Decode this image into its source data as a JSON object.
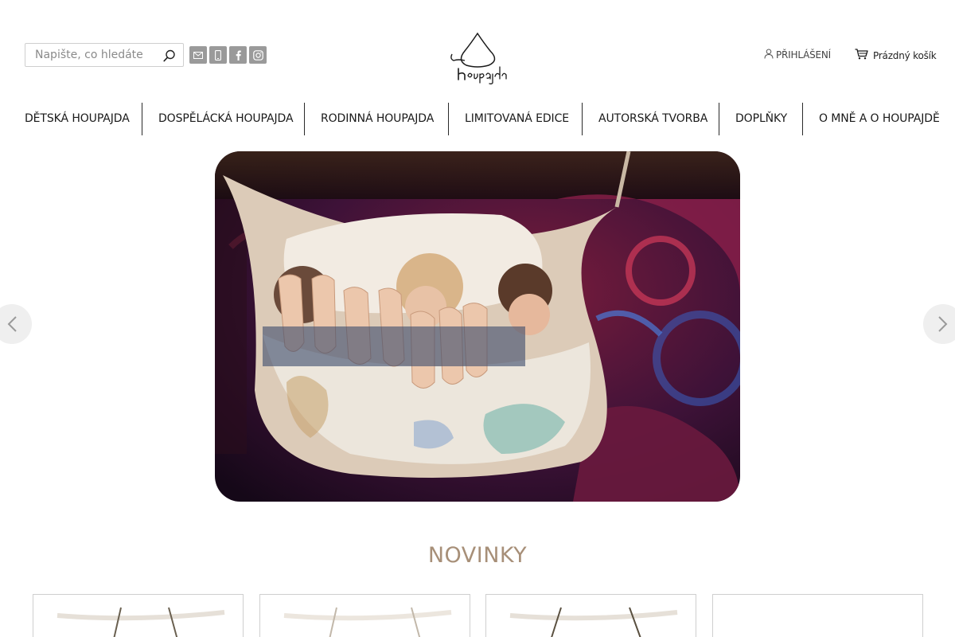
{
  "header": {
    "search": {
      "placeholder": "Napište, co hledáte"
    },
    "social_icons": [
      "email-icon",
      "phone-icon",
      "facebook-icon",
      "instagram-icon"
    ],
    "logo_text": "Houpajda",
    "login_label": "PŘIHLÁŠENÍ",
    "cart_label": "Prázdný košík"
  },
  "nav": {
    "items": [
      "DĚTSKÁ HOUPAJDA",
      "DOSPĚLÁCKÁ HOUPAJDA",
      "RODINNÁ HOUPAJDA",
      "LIMITOVANÁ EDICE",
      "AUTORSKÁ TVORBA",
      "DOPLŇKY",
      "O MNĚ A O HOUPAJDĚ"
    ]
  },
  "hero": {
    "image": "children-feet-in-hammock-photo"
  },
  "sections": {
    "new_title": "NOVINKY"
  },
  "colors": {
    "accent": "#a78f78",
    "icon_gray": "#9a9a9a",
    "nav_separator": "#2a2a2a"
  }
}
